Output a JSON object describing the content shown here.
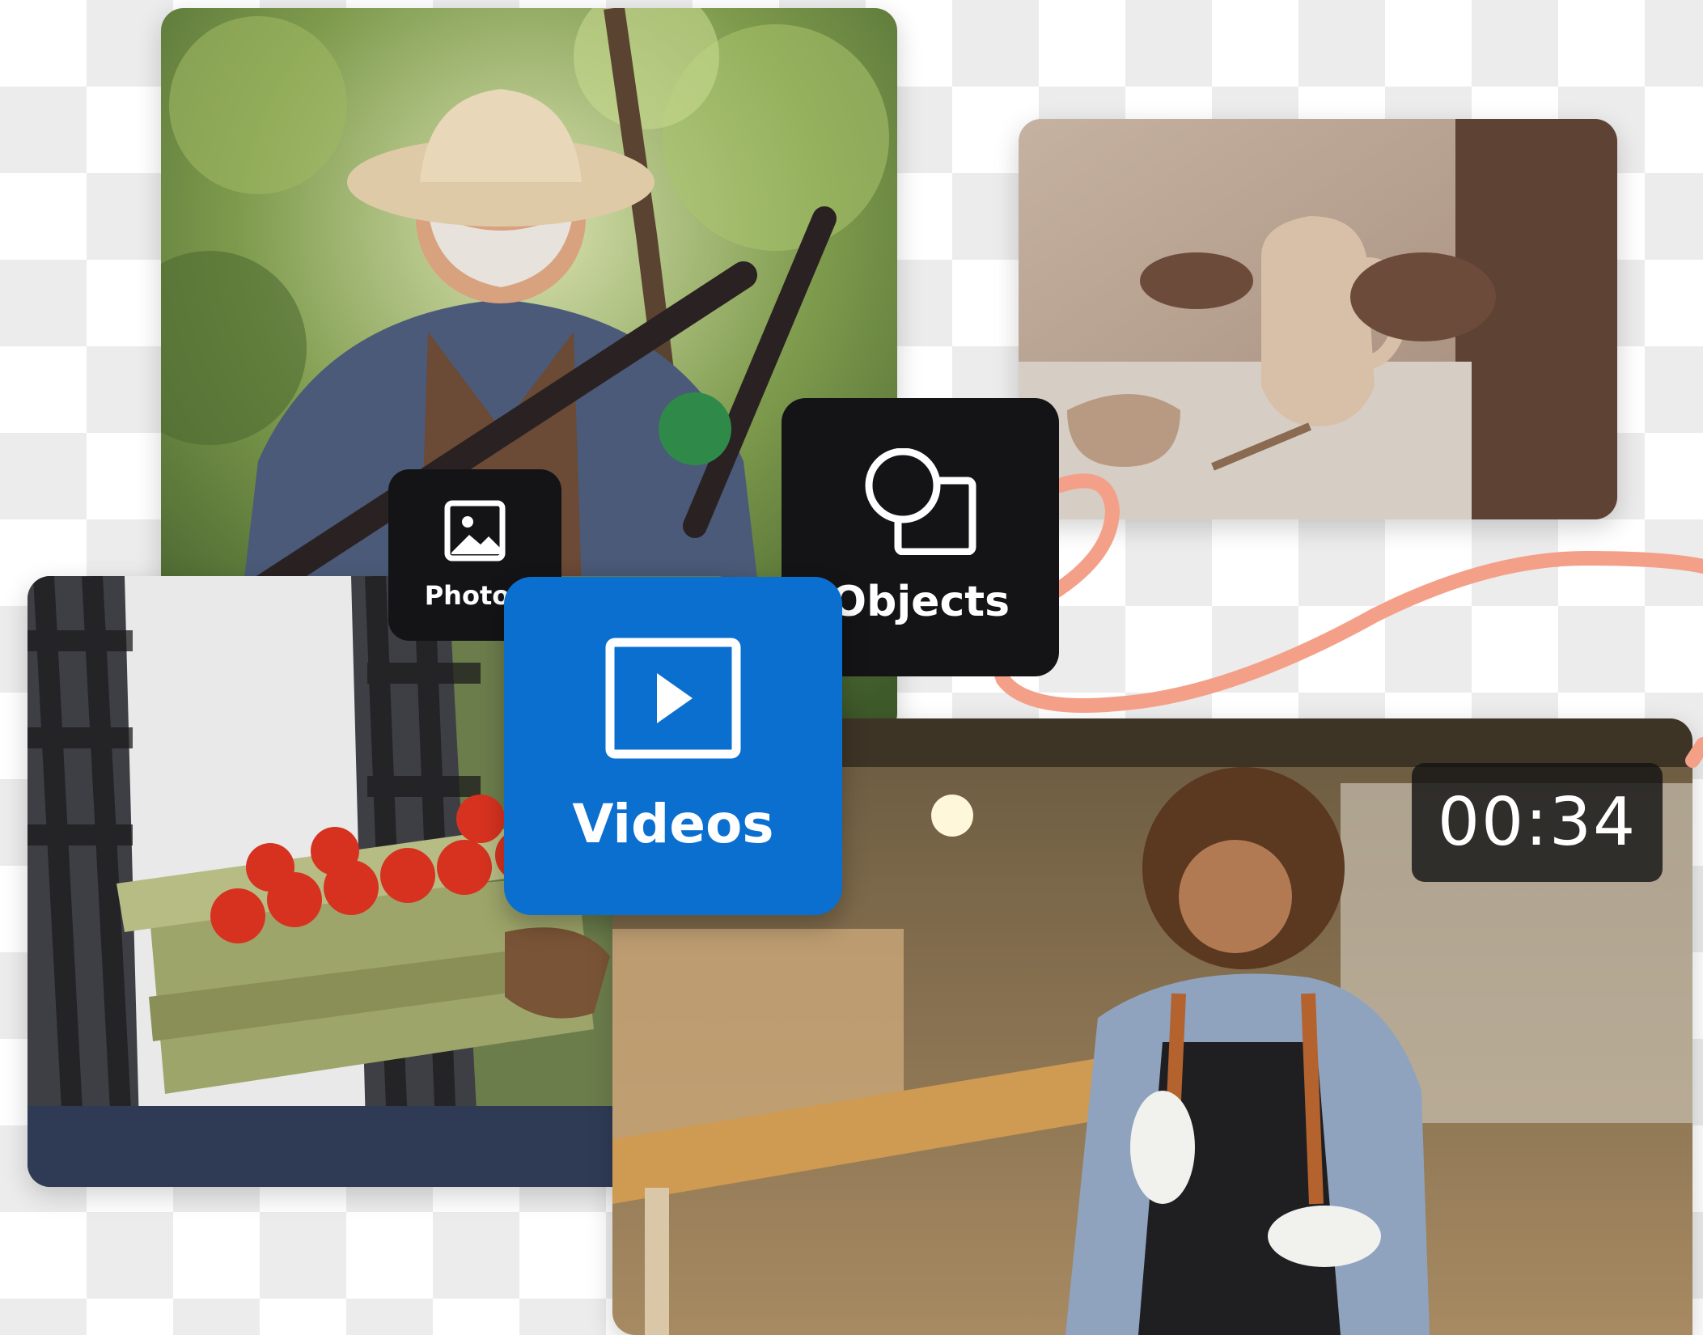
{
  "chips": {
    "photos": {
      "label": "Photos",
      "icon": "image-icon"
    },
    "objects": {
      "label": "Objects",
      "icon": "shapes-icon"
    },
    "videos": {
      "label": "Videos",
      "icon": "play-icon"
    }
  },
  "video_timer": "00:34",
  "colors": {
    "accent_blue": "#0b6fcf",
    "chip_dark": "#141417",
    "squiggle": "#f4a089",
    "checker": "#ececec"
  }
}
